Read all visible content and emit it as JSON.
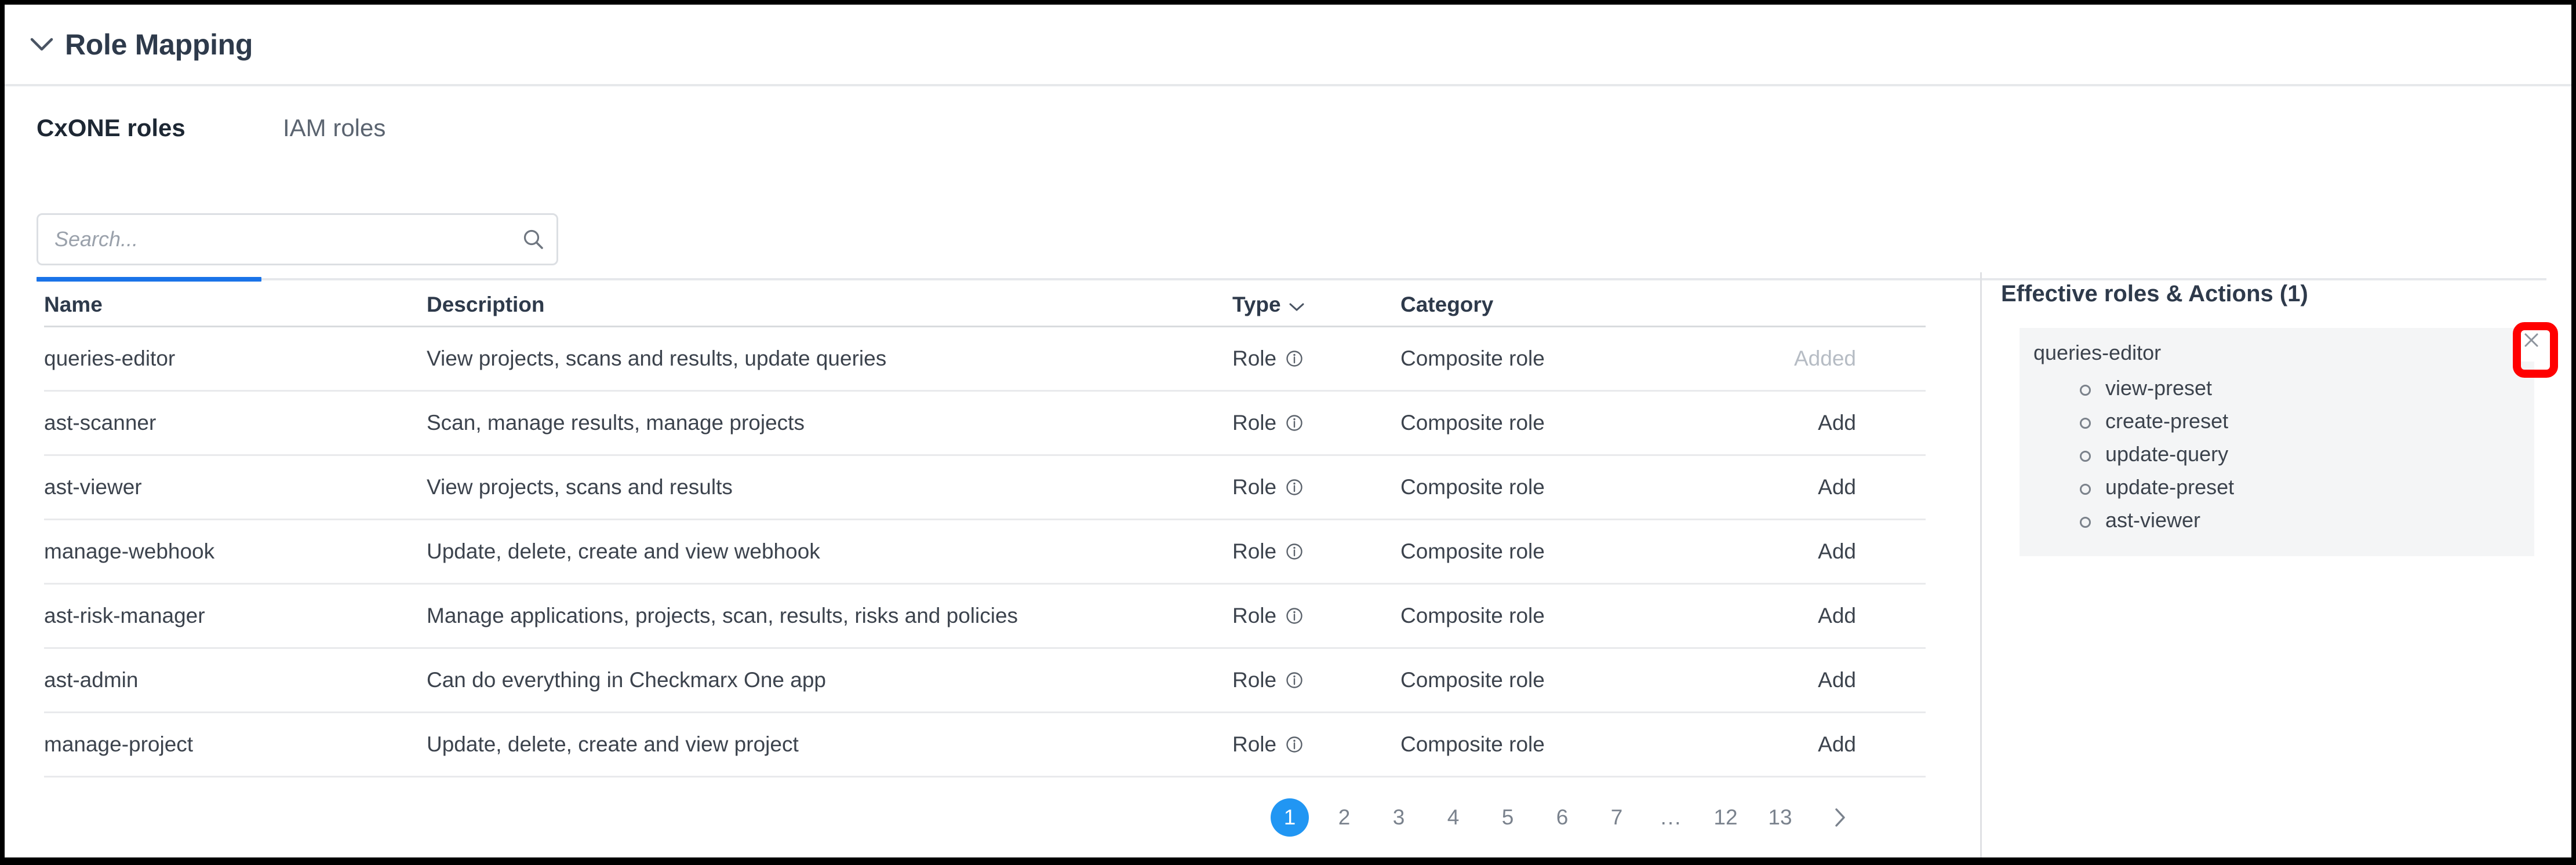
{
  "header": {
    "title": "Role Mapping",
    "collapse_icon": "chevron-down-icon"
  },
  "tabs": [
    {
      "label": "CxONE roles",
      "active": true
    },
    {
      "label": "IAM roles",
      "active": false
    }
  ],
  "search": {
    "placeholder": "Search...",
    "value": "",
    "icon": "search-icon"
  },
  "table": {
    "columns": [
      "Name",
      "Description",
      "Type",
      "Category",
      ""
    ],
    "type_sort_icon": "chevron-down-icon",
    "row_info_icon": "info-icon",
    "rows": [
      {
        "name": "queries-editor",
        "description": "View projects, scans and results, update queries",
        "type": "Role",
        "category": "Composite role",
        "action": "Added",
        "action_state": "added"
      },
      {
        "name": "ast-scanner",
        "description": "Scan, manage results, manage projects",
        "type": "Role",
        "category": "Composite role",
        "action": "Add",
        "action_state": "add"
      },
      {
        "name": "ast-viewer",
        "description": "View projects, scans and results",
        "type": "Role",
        "category": "Composite role",
        "action": "Add",
        "action_state": "add"
      },
      {
        "name": "manage-webhook",
        "description": "Update, delete, create and view webhook",
        "type": "Role",
        "category": "Composite role",
        "action": "Add",
        "action_state": "add"
      },
      {
        "name": "ast-risk-manager",
        "description": "Manage applications, projects, scan, results, risks and policies",
        "type": "Role",
        "category": "Composite role",
        "action": "Add",
        "action_state": "add"
      },
      {
        "name": "ast-admin",
        "description": "Can do everything in Checkmarx One app",
        "type": "Role",
        "category": "Composite role",
        "action": "Add",
        "action_state": "add"
      },
      {
        "name": "manage-project",
        "description": "Update, delete, create and view project",
        "type": "Role",
        "category": "Composite role",
        "action": "Add",
        "action_state": "add"
      }
    ]
  },
  "pagination": {
    "pages": [
      "1",
      "2",
      "3",
      "4",
      "5",
      "6",
      "7",
      "...",
      "12",
      "13"
    ],
    "current": "1",
    "next_icon": "chevron-right-icon"
  },
  "effective_panel": {
    "title": "Effective roles & Actions (1)",
    "role_name": "queries-editor",
    "close_icon": "close-icon",
    "actions": [
      "view-preset",
      "create-preset",
      "update-query",
      "update-preset",
      "ast-viewer"
    ]
  },
  "colors": {
    "accent_blue": "#1a73e8",
    "pagination_active": "#2196f3",
    "highlight_red": "#ff0000",
    "text_primary": "#2e3a4b",
    "text_body": "#3c434d",
    "text_muted": "#b6bcc4",
    "panel_bg": "#f4f5f6",
    "border": "#e9eaec"
  }
}
